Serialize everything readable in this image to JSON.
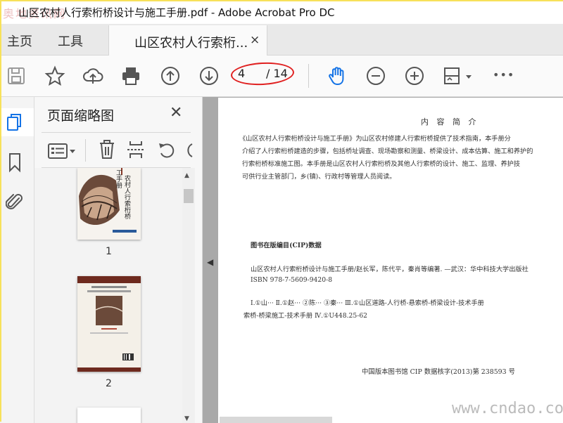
{
  "window": {
    "title": "山区农村人行索桁桥设计与施工手册.pdf - Adobe Acrobat Pro DC"
  },
  "watermark_logo": "奥地资讯网",
  "tabs": {
    "home": "主页",
    "tools": "工具"
  },
  "doc_tab": {
    "label": "山区农村人行索桁...",
    "close": "×"
  },
  "toolbar": {
    "icons": [
      "save-icon",
      "star-icon",
      "upload-cloud-icon",
      "print-icon",
      "prev-page-icon",
      "next-page-icon",
      "hand-tool-icon",
      "zoom-out-icon",
      "zoom-in-icon",
      "fit-page-icon",
      "more-icon"
    ],
    "page_current": "4",
    "page_total": "/ 14",
    "more": "•••"
  },
  "colors": {
    "accent": "#1473e6",
    "highlight_oval": "#e02020"
  },
  "panel": {
    "title": "页面缩略图",
    "close": "✕",
    "thumbnails": [
      {
        "label": "1"
      },
      {
        "label": "2"
      }
    ]
  },
  "document": {
    "intro_title": "内 容 简 介",
    "intro_lines": [
      "《山区农村人行索桁桥设计与施工手册》为山区农村修建人行索桁桥提供了技术指南，本手册分",
      "介绍了人行索桁桥建造的步骤，包括桥址调查、现场勘察和测量、桥梁设计、成本估算、施工和养护的",
      "行索桁桥标准施工图。本手册是山区农村人行索桁桥及其他人行索桥的设计、施工、监理、养护技",
      "可供行业主管部门，乡(镇)、行政村等管理人员阅读。"
    ],
    "cip_heading": "图书在版编目(CIP)数据",
    "cip_lines": [
      "山区农村人行索桁桥设计与施工手册/赵长军，陈代平，秦肖等编著. —武汉：华中科技大学出版社",
      "ISBN 978-7-5609-9420-8",
      "Ⅰ.①山···   Ⅱ.①赵···  ②陈···  ③秦···   Ⅲ.①山区道路-人行桥-悬索桥-桥梁设计-技术手册",
      "索桥-桥梁施工-技术手册   Ⅳ.①U448.25-62"
    ],
    "cip_number": "中国版本图书馆 CIP 数据核字(2013)第 238593 号"
  },
  "watermark_site": "www.cndao.com"
}
